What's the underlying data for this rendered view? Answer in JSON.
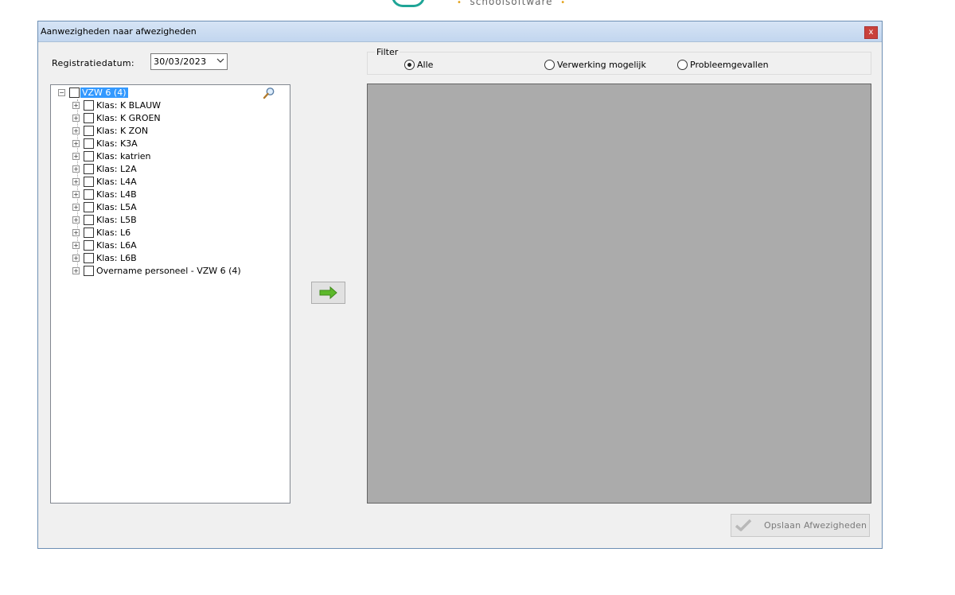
{
  "brand": {
    "text": "schoolsoftware"
  },
  "window": {
    "title": "Aanwezigheden naar afwezigheden",
    "close_label": "x"
  },
  "registration": {
    "label": "Registratiedatum:",
    "date_value": "30/03/2023"
  },
  "tree": {
    "root": "VZW 6 (4)",
    "items": [
      "Klas: K BLAUW",
      "Klas: K GROEN",
      "Klas: K ZON",
      "Klas: K3A",
      "Klas: katrien",
      "Klas: L2A",
      "Klas: L4A",
      "Klas: L4B",
      "Klas: L5A",
      "Klas: L5B",
      "Klas: L6",
      "Klas: L6A",
      "Klas: L6B",
      "Overname personeel - VZW 6 (4)"
    ]
  },
  "filter": {
    "legend": "Filter",
    "options": [
      {
        "label": "Alle",
        "selected": true
      },
      {
        "label": "Verwerking mogelijk",
        "selected": false
      },
      {
        "label": "Probleemgevallen",
        "selected": false
      }
    ]
  },
  "save_button": {
    "label": "Opslaan Afwezigheden"
  },
  "colors": {
    "accent_green": "#4caf1e",
    "selection": "#3399ff",
    "grid_bg": "#ababab"
  }
}
